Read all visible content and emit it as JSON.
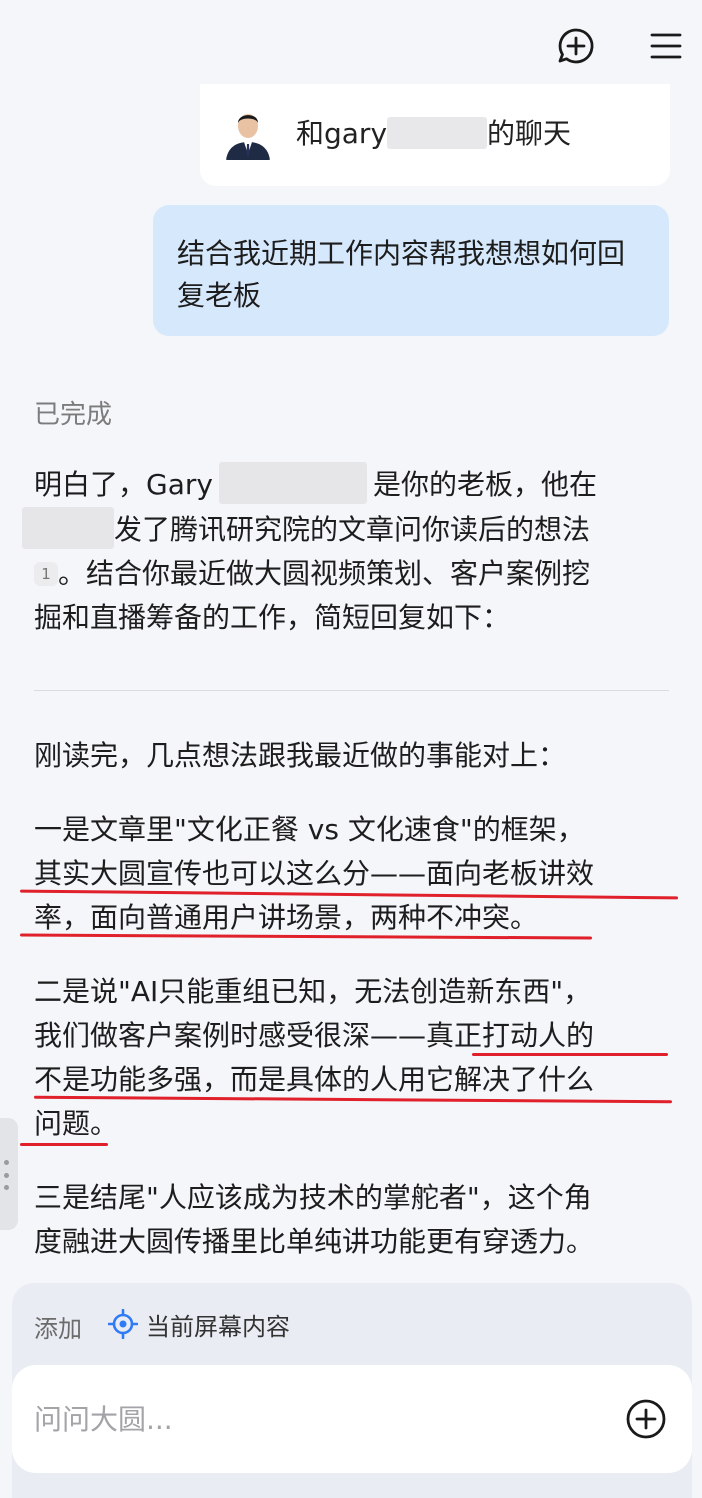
{
  "header": {
    "new_chat_icon": "chat-plus-icon",
    "menu_icon": "hamburger-menu-icon"
  },
  "context": {
    "title_prefix": "和gary",
    "title_suffix": "的聊天"
  },
  "user_message": "结合我近期工作内容帮我想想如何回复老板",
  "status": "已完成",
  "answer": {
    "intro_line1_a": "明白了，Gary",
    "intro_line1_b": "是你的老板，他在",
    "intro_line2": "发了腾讯研究院的文章问你读后的想法",
    "citation": "1",
    "intro_line3": "。结合你最近做大圆视频策划、客户案例挖",
    "intro_line4": "掘和直播筹备的工作，简短回复如下：",
    "p0": "刚读完，几点想法跟我最近做的事能对上：",
    "p1_line1": "一是文章里\"文化正餐 vs 文化速食\"的框架，",
    "p1_line2": "其实大圆宣传也可以这么分——面向老板讲效",
    "p1_line3": "率，面向普通用户讲场景，两种不冲突。",
    "p2_line1": "二是说\"AI只能重组已知，无法创造新东西\"，",
    "p2_line2": "我们做客户案例时感受很深——真正打动人的",
    "p2_line3": "不是功能多强，而是具体的人用它解决了什么",
    "p2_line4": "问题。",
    "p3_line1": "三是结尾\"人应该成为技术的掌舵者\"，这个角",
    "p3_line2": "度融进大圆传播里比单纯讲功能更有穿透力。"
  },
  "composer": {
    "add_label": "添加",
    "screen_chip_label": "当前屏幕内容",
    "screen_chip_icon": "target-icon",
    "input_placeholder": "问问大圆...",
    "plus_icon": "plus-circle-icon"
  },
  "colors": {
    "user_bubble": "#d6e8fb",
    "underline": "#e0202a",
    "accent": "#2f7bf6"
  }
}
